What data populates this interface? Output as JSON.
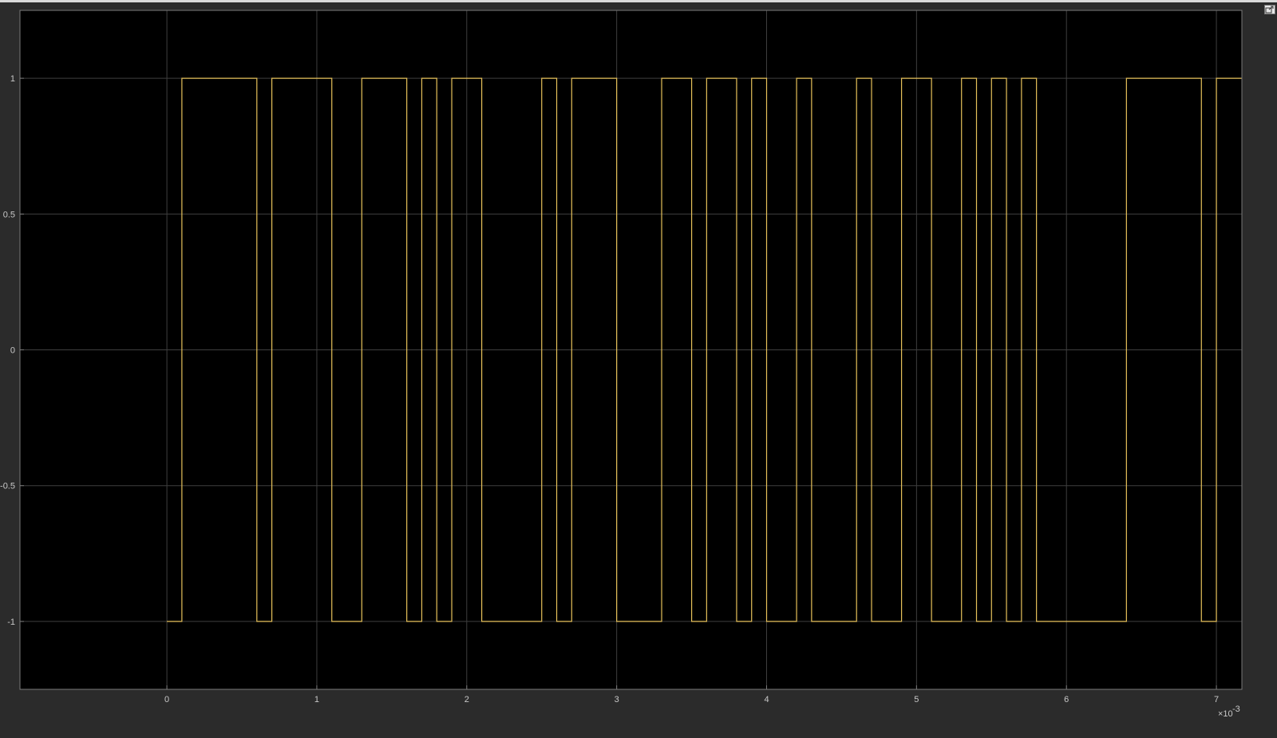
{
  "window": {
    "undock_icon": "undock-icon"
  },
  "colors": {
    "background": "#2b2b2b",
    "axes_background": "#000000",
    "grid": "#3f3f3f",
    "axes_border": "#7a7a7a",
    "tick_text": "#c8c8c8",
    "signal": "#e6c15a"
  },
  "chart_data": {
    "type": "line",
    "step": true,
    "title": "",
    "xlabel": "",
    "ylabel": "",
    "grid": true,
    "x_scale_factor": "×10",
    "x_scale_exponent": "-3",
    "xlim": [
      -0.98,
      7.17
    ],
    "ylim": [
      -1.25,
      1.25
    ],
    "x_ticks": [
      0,
      1,
      2,
      3,
      4,
      5,
      6,
      7
    ],
    "x_tick_labels": [
      "0",
      "1",
      "2",
      "3",
      "4",
      "5",
      "6",
      "7"
    ],
    "y_ticks": [
      -1,
      -0.5,
      0,
      0.5,
      1
    ],
    "y_tick_labels": [
      "-1",
      "-0.5",
      "0",
      "0.5",
      "1"
    ],
    "series": [
      {
        "x": [
          0,
          0.1,
          0.6,
          0.7,
          1.1,
          1.3,
          1.6,
          1.7,
          1.8,
          1.9,
          2.1,
          2.5,
          2.6,
          2.7,
          3.0,
          3.3,
          3.5,
          3.6,
          3.8,
          3.9,
          4.0,
          4.2,
          4.3,
          4.6,
          4.7,
          4.9,
          5.1,
          5.3,
          5.4,
          5.5,
          5.6,
          5.7,
          5.8,
          6.4,
          6.9,
          7.0,
          7.17
        ],
        "y": [
          -1,
          1,
          -1,
          1,
          -1,
          1,
          -1,
          1,
          -1,
          1,
          -1,
          1,
          -1,
          1,
          -1,
          1,
          -1,
          1,
          -1,
          1,
          -1,
          1,
          -1,
          1,
          -1,
          1,
          -1,
          1,
          -1,
          1,
          -1,
          1,
          -1,
          1,
          -1,
          1,
          1
        ]
      }
    ]
  }
}
